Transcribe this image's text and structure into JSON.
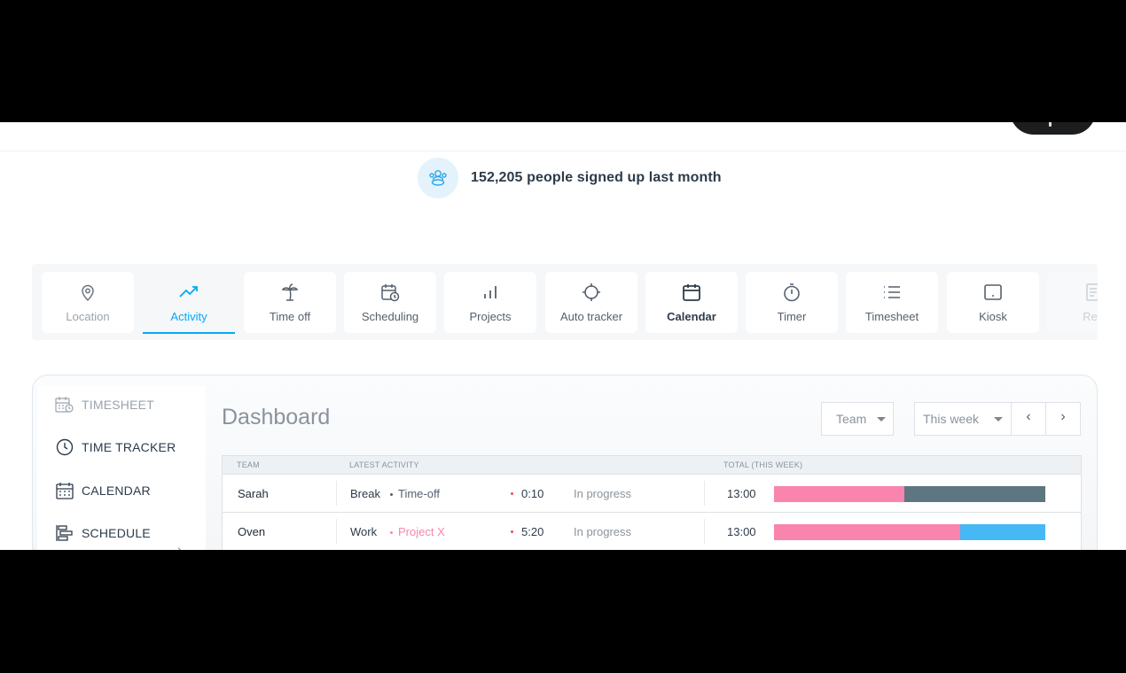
{
  "signup": {
    "text": "152,205 people signed up last month",
    "icon": "users-icon"
  },
  "features": {
    "items": [
      {
        "label": "Location",
        "icon": "map-pin-icon",
        "state": "dim"
      },
      {
        "label": "Activity",
        "icon": "trending-up-icon",
        "state": "active"
      },
      {
        "label": "Time off",
        "icon": "palm-tree-icon",
        "state": "normal"
      },
      {
        "label": "Scheduling",
        "icon": "calendar-clock-icon",
        "state": "normal"
      },
      {
        "label": "Projects",
        "icon": "bar-chart-icon",
        "state": "normal"
      },
      {
        "label": "Auto tracker",
        "icon": "crosshair-icon",
        "state": "normal"
      },
      {
        "label": "Calendar",
        "icon": "calendar-icon",
        "state": "bold"
      },
      {
        "label": "Timer",
        "icon": "stopwatch-icon",
        "state": "normal"
      },
      {
        "label": "Timesheet",
        "icon": "list-icon",
        "state": "normal"
      },
      {
        "label": "Kiosk",
        "icon": "tablet-icon",
        "state": "normal"
      },
      {
        "label": "Rep",
        "icon": "report-icon",
        "state": "faded"
      }
    ],
    "accent": "#03a9f4"
  },
  "sidebar": {
    "items": [
      {
        "label": "TIMESHEET",
        "icon": "timesheet-icon"
      },
      {
        "label": "TIME TRACKER",
        "icon": "clock-icon"
      },
      {
        "label": "CALENDAR",
        "icon": "calendar-icon"
      },
      {
        "label": "SCHEDULE",
        "icon": "schedule-icon"
      }
    ],
    "schedule_chevron": "›"
  },
  "dashboard": {
    "title": "Dashboard",
    "team_select": "Team",
    "range_select": "This week",
    "prev": "‹",
    "next": "›"
  },
  "table": {
    "headers": {
      "team": "TEAM",
      "latest": "LATEST ACTIVITY",
      "total": "TOTAL (THIS WEEK)"
    },
    "rows": [
      {
        "name": "Sarah",
        "activity": "Break",
        "tag": "Time-off",
        "tag_color": "#55606c",
        "time": "0:10",
        "status": "In progress",
        "total": "13:00",
        "bar_first_fraction": 0.48,
        "bar_first_color": "#f984ae",
        "bar_second_color": "#5d7682"
      },
      {
        "name": "Oven",
        "activity": "Work",
        "tag": "Project X",
        "tag_color": "#f984ae",
        "time": "5:20",
        "status": "In progress",
        "total": "13:00",
        "bar_first_fraction": 0.685,
        "bar_first_color": "#f984ae",
        "bar_second_color": "#45b8f5"
      }
    ]
  }
}
